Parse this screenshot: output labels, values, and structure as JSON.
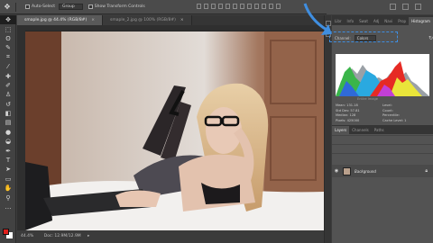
{
  "options_bar": {
    "auto_select_label": "Auto-Select",
    "auto_select_value": "Group",
    "show_transform_label": "Show Transform Controls"
  },
  "document_tabs": [
    {
      "label": "smaple.jpg @ 44.4% (RGB/8#)",
      "close": "×",
      "active": true
    },
    {
      "label": "smaple_2.jpg @ 100% (RGB/8#)",
      "close": "×",
      "active": false
    }
  ],
  "status": {
    "zoom": "44.4%",
    "doc": "Doc: 12.9M/12.9M"
  },
  "top_panel": {
    "tabs": [
      "Libr",
      "Info",
      "Swat",
      "Adj",
      "Navi",
      "Prop",
      "Histogram"
    ],
    "channel_label": "Channel:",
    "channel_value": "Colors",
    "source_text": "Entire Image"
  },
  "stats": {
    "left": [
      [
        "Mean:",
        "131.18"
      ],
      [
        "Std Dev:",
        "57.81"
      ],
      [
        "Median:",
        "128"
      ],
      [
        "Pixels:",
        "425000"
      ]
    ],
    "right": [
      [
        "Level:",
        ""
      ],
      [
        "Count:",
        ""
      ],
      [
        "Percentile:",
        ""
      ],
      [
        "Cache Level:",
        "1"
      ]
    ]
  },
  "layers_panel": {
    "tabs": [
      "Layers",
      "Channels",
      "Paths"
    ],
    "layer_name": "Background"
  },
  "colors": {
    "accent": "#3f8ee0",
    "foreground": "#e0201c",
    "background": "#ffffff"
  }
}
